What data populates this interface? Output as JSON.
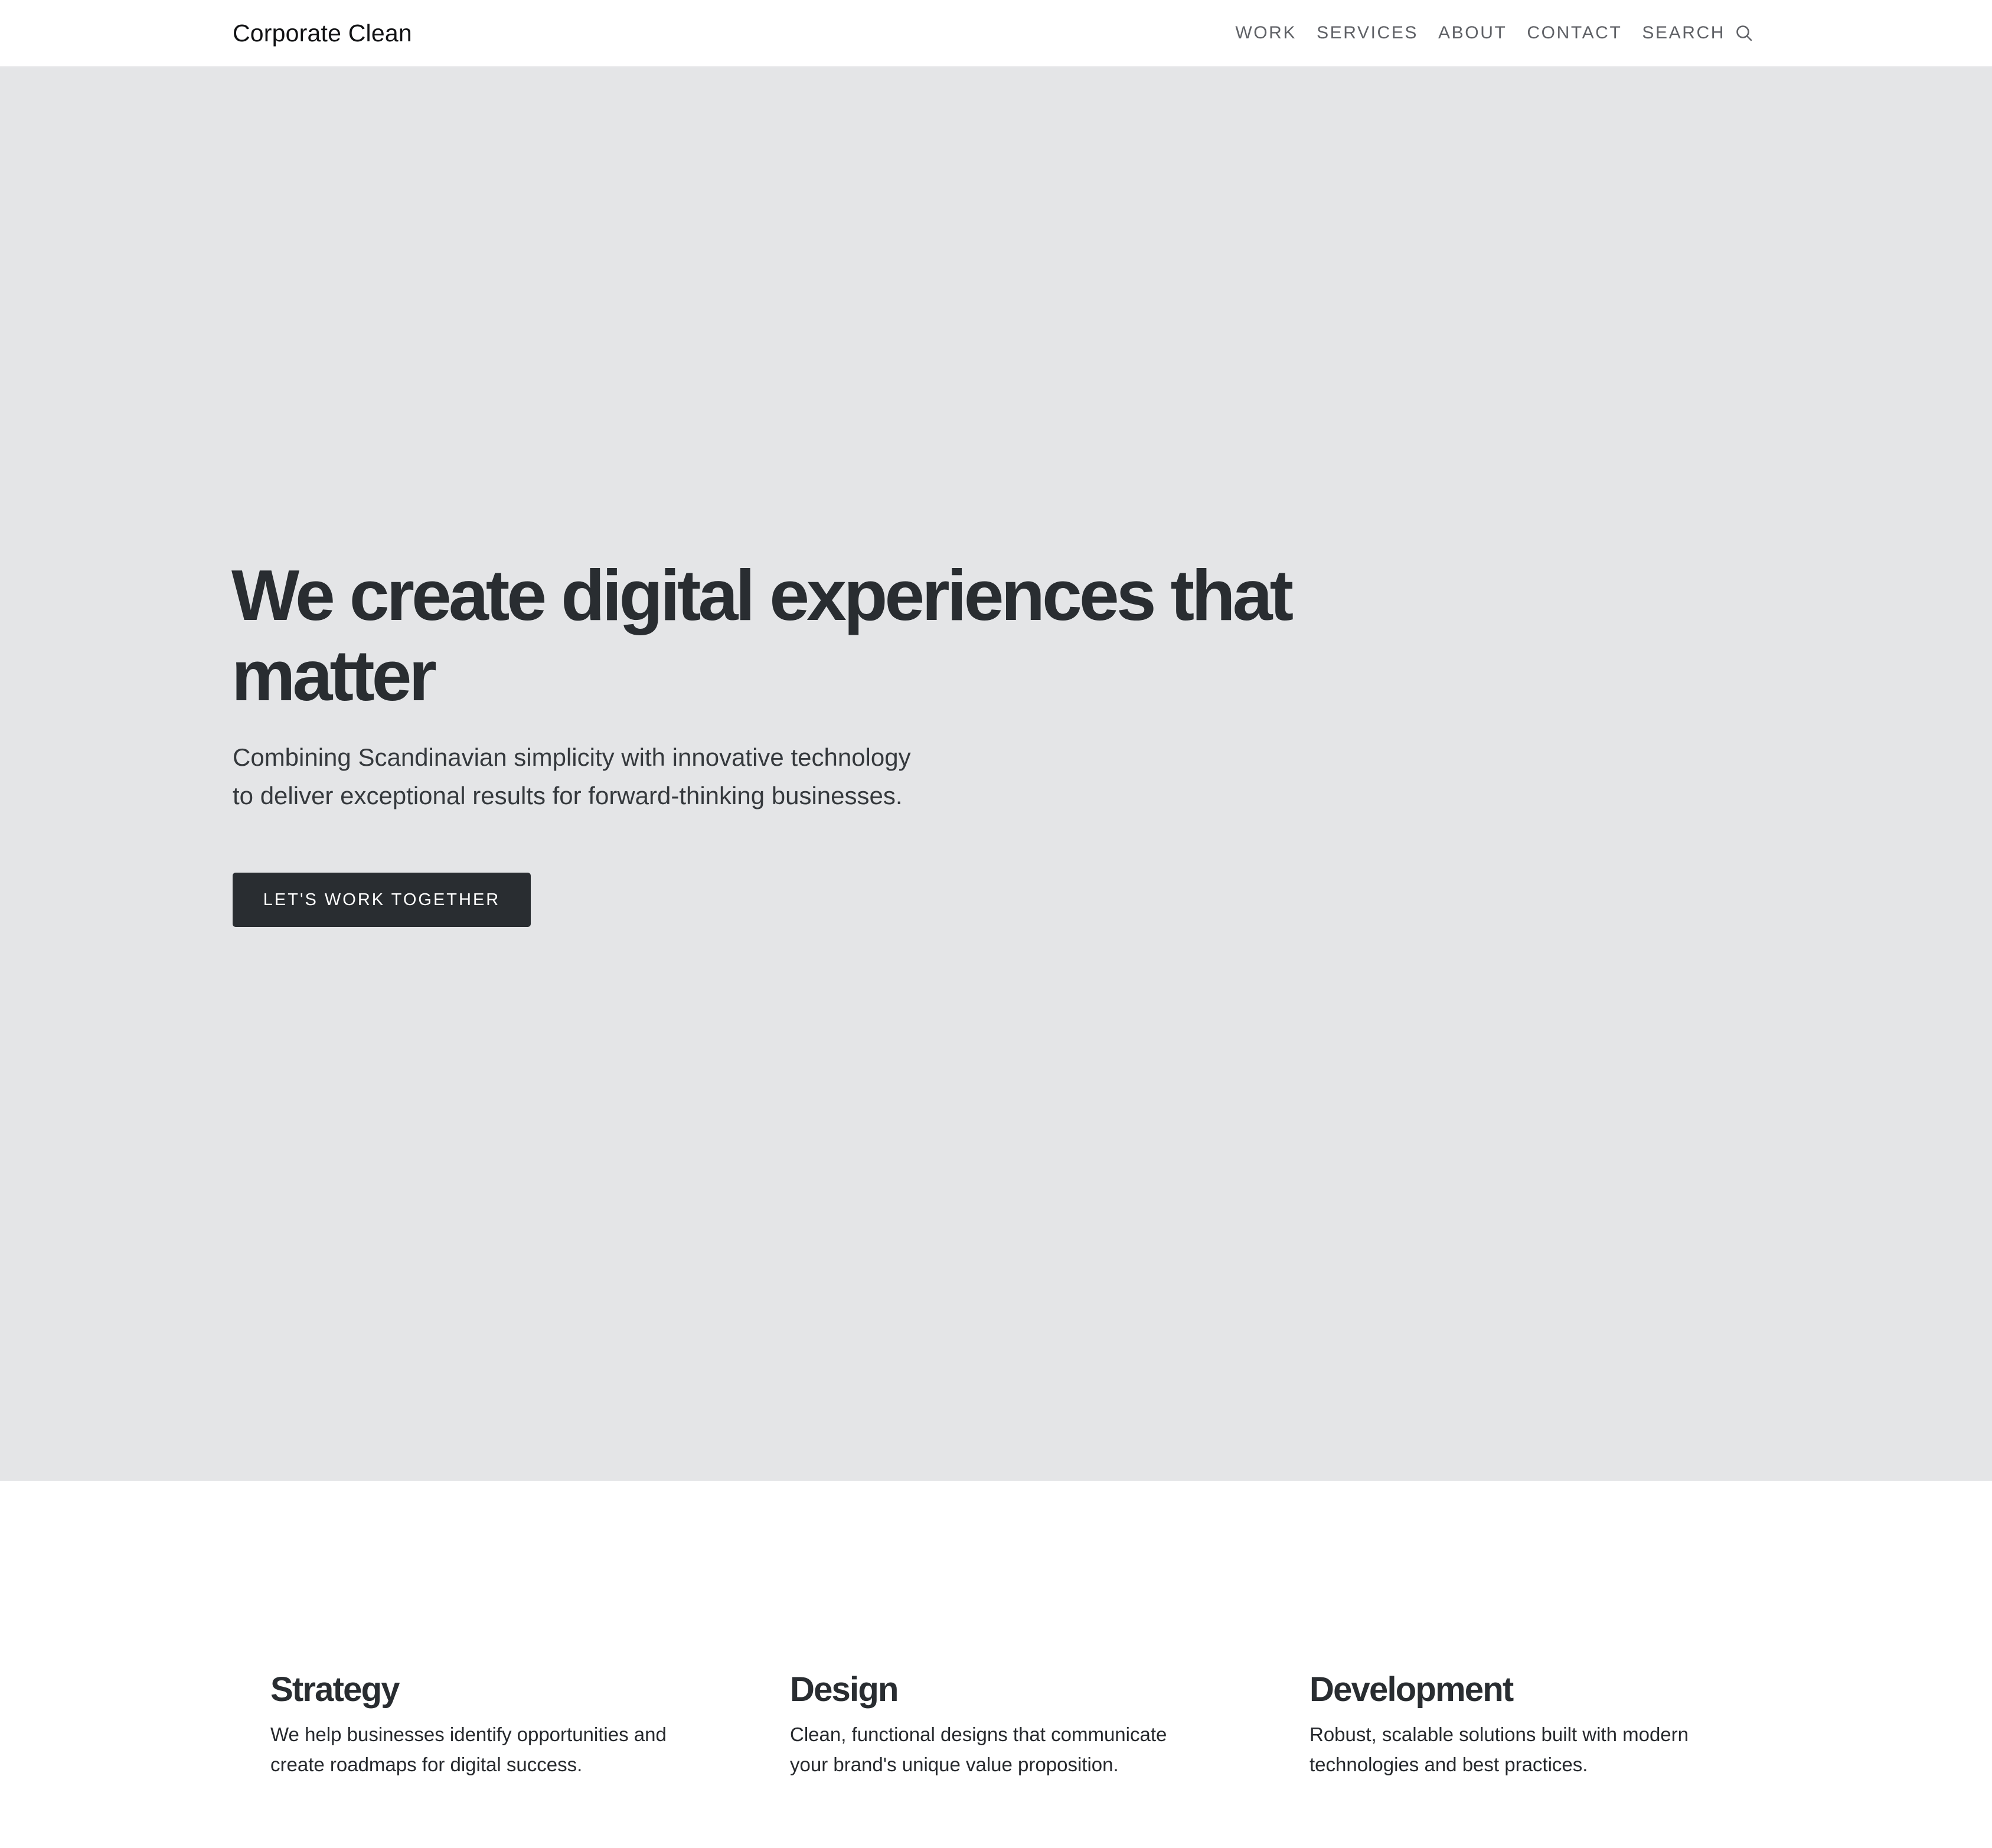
{
  "header": {
    "brand": "Corporate Clean",
    "nav": {
      "work": "WORK",
      "services": "SERVICES",
      "about": "ABOUT",
      "contact": "CONTACT",
      "search": "SEARCH"
    },
    "search_icon": "search-icon"
  },
  "hero": {
    "title": "We create digital experiences that matter",
    "subtitle_line1": "Combining Scandinavian simplicity with innovative technology",
    "subtitle_line2": "to deliver exceptional results for forward-thinking businesses.",
    "cta_label": "LET'S WORK TOGETHER"
  },
  "services": [
    {
      "title": "Strategy",
      "line1": "We help businesses identify opportunities and",
      "line2": "create roadmaps for digital success."
    },
    {
      "title": "Design",
      "line1": "Clean, functional designs that communicate",
      "line2": "your brand's unique value proposition."
    },
    {
      "title": "Development",
      "line1": "Robust, scalable solutions built with modern",
      "line2": "technologies and best practices."
    }
  ],
  "colors": {
    "header_bg": "#ffffff",
    "hero_bg": "#e4e5e7",
    "text_dark": "#292d31",
    "nav_text": "#5f6166",
    "button_bg": "#292d31",
    "button_text": "#ffffff"
  }
}
